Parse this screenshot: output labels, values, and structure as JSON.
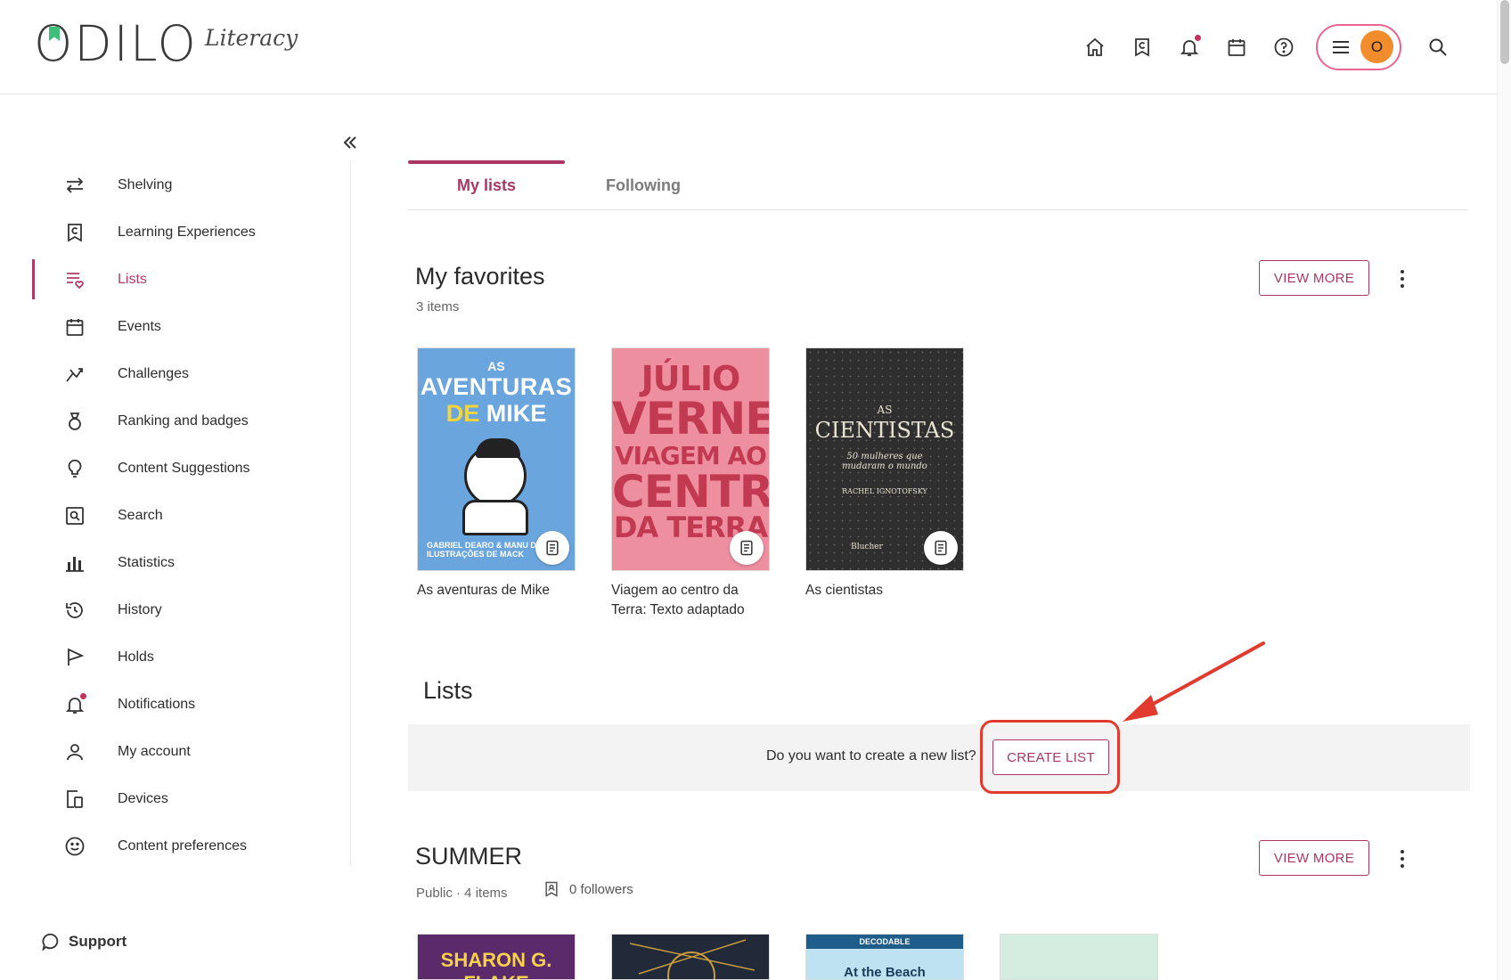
{
  "brand": {
    "name": "ODILO",
    "product": "Literacy",
    "accent": "#a83863"
  },
  "header": {
    "avatar_initial": "O",
    "icons": [
      "home-icon",
      "learning-icon",
      "bell-icon",
      "calendar-icon",
      "help-icon",
      "menu-icon",
      "search-icon"
    ]
  },
  "sidebar": {
    "items": [
      {
        "label": "Shelving",
        "icon": "swap-arrows-icon"
      },
      {
        "label": "Learning Experiences",
        "icon": "learning-bookmark-icon"
      },
      {
        "label": "Lists",
        "icon": "list-heart-icon",
        "active": true
      },
      {
        "label": "Events",
        "icon": "calendar-icon"
      },
      {
        "label": "Challenges",
        "icon": "challenge-icon"
      },
      {
        "label": "Ranking and badges",
        "icon": "medal-icon"
      },
      {
        "label": "Content Suggestions",
        "icon": "lightbulb-icon"
      },
      {
        "label": "Search",
        "icon": "search-box-icon"
      },
      {
        "label": "Statistics",
        "icon": "bar-chart-icon"
      },
      {
        "label": "History",
        "icon": "history-icon"
      },
      {
        "label": "Holds",
        "icon": "flag-icon"
      },
      {
        "label": "Notifications",
        "icon": "bell-icon"
      },
      {
        "label": "My account",
        "icon": "user-icon"
      },
      {
        "label": "Devices",
        "icon": "devices-icon"
      },
      {
        "label": "Content preferences",
        "icon": "smiley-icon"
      }
    ],
    "support_label": "Support"
  },
  "tabs": [
    {
      "label": "My lists",
      "active": true
    },
    {
      "label": "Following",
      "active": false
    }
  ],
  "favorites": {
    "title": "My favorites",
    "count": "3 items",
    "view_more": "VIEW MORE",
    "books": [
      {
        "title": "As aventuras de Mike",
        "cover": {
          "line1": "AS",
          "line2": "AVENTURAS",
          "line3a": "DE ",
          "line3b": "MIKE",
          "credit": "GABRIEL DEARO & MANU D · ILUSTRAÇÕES DE MACK"
        }
      },
      {
        "title": "Viagem ao centro da Terra: Texto adaptado",
        "cover": {
          "a": "JÚLIO",
          "b": "VERNE",
          "c": "VIAGEM AO",
          "d": "CENTRO",
          "e": "DA TERRA"
        }
      },
      {
        "title": "As cientistas",
        "cover": {
          "a": "AS",
          "b": "CIENTISTAS",
          "c": "50 mulheres que mudaram o mundo",
          "d": "RACHEL IGNOTOFSKY",
          "e": "Blucher"
        }
      }
    ]
  },
  "lists_section": {
    "title": "Lists",
    "prompt": "Do you want to create a new list?",
    "create_label": "CREATE LIST"
  },
  "summer": {
    "title": "SUMMER",
    "meta": "Public · 4 items",
    "followers": "0 followers",
    "view_more": "VIEW MORE",
    "covers": [
      {
        "text": "SHARON G. FLAKE"
      },
      {
        "text": ""
      },
      {
        "tag": "DECODABLE",
        "text": "At the Beach"
      },
      {
        "text": ""
      }
    ]
  }
}
